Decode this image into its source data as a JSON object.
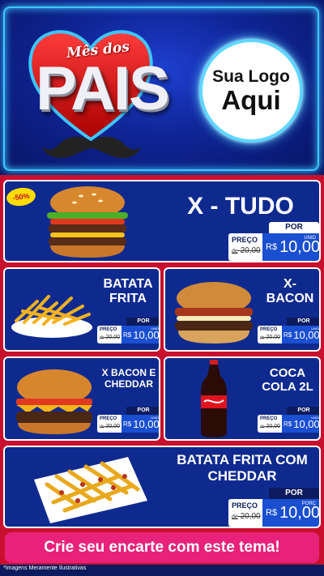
{
  "header": {
    "title_small": "Mês dos",
    "title_big": "PAIS",
    "logo_line1": "Sua Logo",
    "logo_line2": "Aqui"
  },
  "colors": {
    "header_blue": "#0f2596",
    "neon": "#3ec6ff",
    "menu_red": "#c8102e",
    "card_blue": "#0f2a8f",
    "price_blue": "#1a4fd1",
    "cta_pink": "#e8227a",
    "badge_yellow": "#ffdd00"
  },
  "promo_badge": "-50%",
  "products": [
    {
      "name": "X - TUDO",
      "icon": "burger-tall-icon",
      "por": "POR",
      "preco": "PREÇO",
      "de": "de",
      "old_price": "20,00",
      "currency": "R$",
      "price": "10,00",
      "unit": "UNID"
    },
    {
      "name": "BATATA FRITA",
      "icon": "fries-plate-icon",
      "por": "POR",
      "preco": "PREÇO",
      "de": "de",
      "old_price": "20,00",
      "currency": "R$",
      "price": "10,00",
      "unit": "UNID"
    },
    {
      "name": "X- BACON",
      "icon": "bacon-burger-icon",
      "por": "POR",
      "preco": "PREÇO",
      "de": "de",
      "old_price": "20,00",
      "currency": "R$",
      "price": "10,00",
      "unit": "UNID"
    },
    {
      "name": "X BACON E CHEDDAR",
      "icon": "cheddar-burger-icon",
      "por": "POR",
      "preco": "PREÇO",
      "de": "de",
      "old_price": "20,00",
      "currency": "R$",
      "price": "10,00",
      "unit": "UNID"
    },
    {
      "name": "COCA COLA 2L",
      "icon": "soda-bottle-icon",
      "por": "POR",
      "preco": "PREÇO",
      "de": "de",
      "old_price": "20,00",
      "currency": "R$",
      "price": "10,00",
      "unit": "UNID"
    },
    {
      "name": "BATATA FRITA COM CHEDDAR",
      "icon": "cheddar-fries-icon",
      "por": "POR",
      "preco": "PREÇO",
      "de": "de",
      "old_price": "20,00",
      "currency": "R$",
      "price": "10,00",
      "unit": "PORÇ"
    }
  ],
  "cta": "Crie seu encarte com este tema!",
  "footnote": "*Imagens Meramente Ilustrativas"
}
